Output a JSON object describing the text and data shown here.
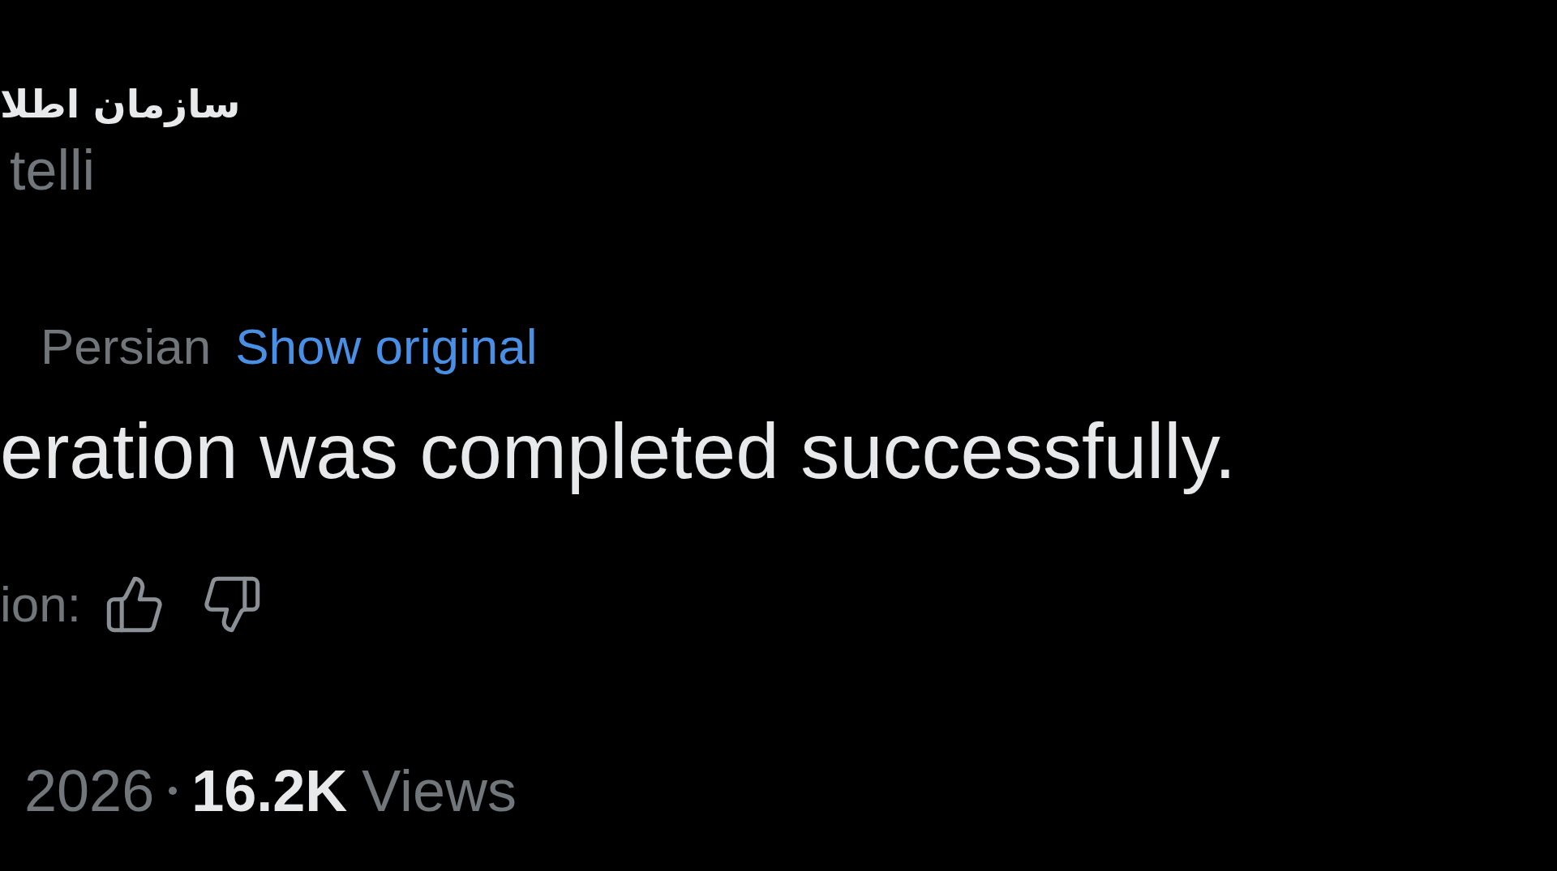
{
  "author": {
    "name": "سازمان اطلا",
    "handle": "telli"
  },
  "translation": {
    "label": "Persian",
    "link": "Show original"
  },
  "post_text": "eration was completed successfully.",
  "rating": {
    "label": "ion:"
  },
  "meta": {
    "date": "2026",
    "views_count": "16.2K",
    "views_label": "Views"
  }
}
